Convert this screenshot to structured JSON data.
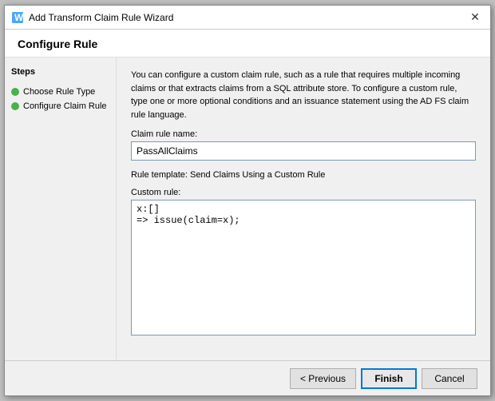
{
  "window": {
    "title": "Add Transform Claim Rule Wizard",
    "close_label": "✕"
  },
  "page_header": {
    "title": "Configure Rule"
  },
  "sidebar": {
    "heading": "Steps",
    "items": [
      {
        "label": "Choose Rule Type",
        "active": true
      },
      {
        "label": "Configure Claim Rule",
        "active": true
      }
    ]
  },
  "main": {
    "description": "You can configure a custom claim rule, such as a rule that requires multiple incoming claims or that extracts claims from a SQL attribute store. To configure a custom rule, type one or more optional conditions and an issuance statement using the AD FS claim rule language.",
    "claim_rule_name_label": "Claim rule name:",
    "claim_rule_name_value": "PassAllClaims",
    "rule_template_text": "Rule template: Send Claims Using a Custom Rule",
    "custom_rule_label": "Custom rule:",
    "custom_rule_value": "x:[]\n=> issue(claim=x);"
  },
  "footer": {
    "previous_label": "< Previous",
    "finish_label": "Finish",
    "cancel_label": "Cancel"
  }
}
